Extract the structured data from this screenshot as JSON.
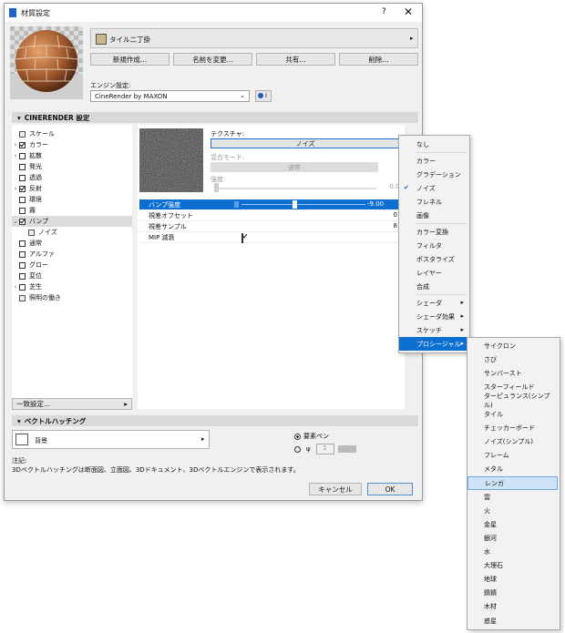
{
  "dialog": {
    "title": "材質設定",
    "help": "?",
    "close": "✕",
    "material_name": "タイル二丁掛",
    "buttons": {
      "new": "新規作成...",
      "rename": "名前を変更...",
      "share": "共有...",
      "delete": "削除..."
    },
    "engine_label": "エンジン設定:",
    "engine_value": "CineRender by MAXON",
    "section_cinerender": "CINERENDER 設定",
    "tree": [
      {
        "label": "スケール",
        "checked": null,
        "expand": false
      },
      {
        "label": "カラー",
        "checked": true,
        "expand": true
      },
      {
        "label": "拡散",
        "checked": false,
        "expand": true
      },
      {
        "label": "発光",
        "checked": false,
        "expand": false
      },
      {
        "label": "透過",
        "checked": false,
        "expand": false
      },
      {
        "label": "反射",
        "checked": true,
        "expand": true
      },
      {
        "label": "環境",
        "checked": false,
        "expand": false
      },
      {
        "label": "霧",
        "checked": false,
        "expand": false
      },
      {
        "label": "バンプ",
        "checked": true,
        "expand": true
      },
      {
        "label": "ノイズ",
        "checked": null,
        "expand": false
      },
      {
        "label": "通常",
        "checked": false,
        "expand": false
      },
      {
        "label": "アルファ",
        "checked": false,
        "expand": false
      },
      {
        "label": "グロー",
        "checked": false,
        "expand": false
      },
      {
        "label": "変位",
        "checked": false,
        "expand": false
      },
      {
        "label": "芝生",
        "checked": false,
        "expand": true
      },
      {
        "label": "照明の働き",
        "checked": null,
        "expand": false
      }
    ],
    "match_settings": "一致設定...",
    "texture_label": "テクスチャ:",
    "texture_value": "ノイズ",
    "blend_label": "混合モード:",
    "blend_value": "通常",
    "strength_label": "強度:",
    "strength_value": "0.00",
    "props": [
      {
        "label": "バンプ強度",
        "value": "-9.00"
      },
      {
        "label": "視差オフセット",
        "value": "0"
      },
      {
        "label": "視差サンプル",
        "value": "8"
      },
      {
        "label": "MIP 減衰",
        "value": ""
      }
    ],
    "section_hatching": "ベクトルハッチング",
    "bg_label": "背景",
    "radio_pen": "要素ペン",
    "pen_number": "1",
    "note_label": "注記:",
    "note_text": "3Dベクトルハッチングは断面図、立面図、3Dドキュメント、3Dベクトルエンジンで表示されます。",
    "cancel": "キャンセル",
    "ok": "OK"
  },
  "menu1": {
    "items": [
      "なし",
      "カラー",
      "グラデーション",
      "ノイズ",
      "フレネル",
      "画像",
      "カラー変換",
      "フィルタ",
      "ポスタライズ",
      "レイヤー",
      "合成",
      "シェーダ",
      "シェーダ効果",
      "スケッチ",
      "プロシージャル"
    ],
    "checked": "ノイズ",
    "selected": "プロシージャル"
  },
  "menu2": {
    "items": [
      "サイクロン",
      "さび",
      "サンバースト",
      "スターフィールド",
      "ターピュランス(シンプル)",
      "タイル",
      "チェッカーボード",
      "ノイズ(シンプル)",
      "フレーム",
      "メタル",
      "レンガ",
      "雲",
      "火",
      "金星",
      "銀河",
      "水",
      "大理石",
      "地球",
      "錆錆",
      "木材",
      "惑星"
    ],
    "highlighted": "レンガ"
  },
  "colors": {
    "accent": "#0c6fd1",
    "highlight": "#cfe3f8"
  }
}
